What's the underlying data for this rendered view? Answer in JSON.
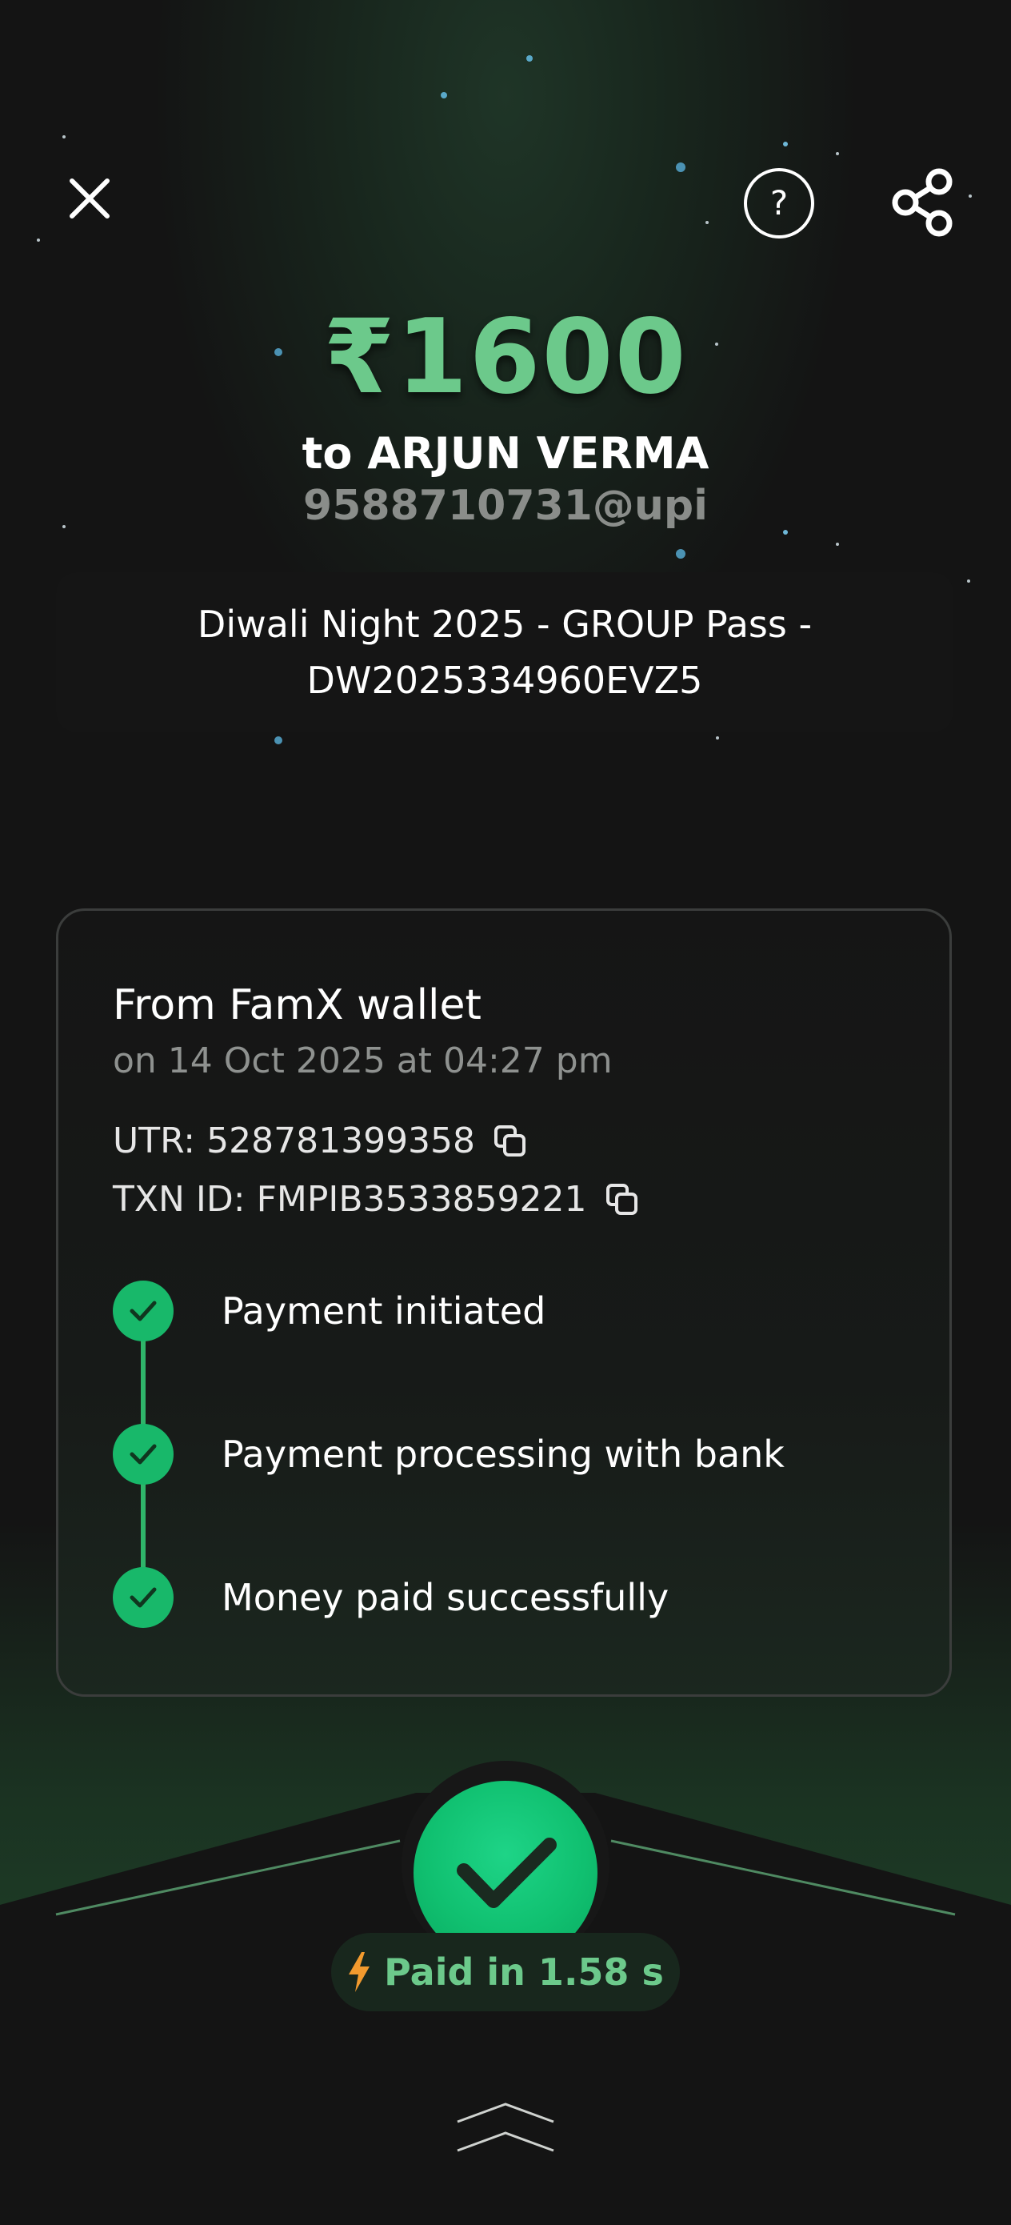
{
  "header": {
    "close_icon": "close-icon",
    "help_icon": "help-circle-icon",
    "share_icon": "share-icon"
  },
  "payment": {
    "amount": "₹1600",
    "recipient": "to ARJUN VERMA",
    "upi_id": "9588710731@upi",
    "note": "Diwali Night 2025 - GROUP Pass - DW2025334960EVZ5"
  },
  "details": {
    "source": "From FamX wallet",
    "datetime": "on 14 Oct 2025 at 04:27 pm",
    "utr": "UTR: 528781399358",
    "txn_id": "TXN ID: FMPIB3533859221",
    "copy_icon": "copy-icon"
  },
  "timeline": [
    {
      "label": "Payment initiated"
    },
    {
      "label": "Payment processing with bank"
    },
    {
      "label": "Money paid successfully"
    }
  ],
  "status": {
    "paid_in": "Paid in 1.58 s",
    "icon": "lightning-icon"
  },
  "colors": {
    "accent_green": "#6cc98b",
    "success_green": "#10c070",
    "background": "#141414",
    "bolt_orange": "#f29a2e"
  }
}
